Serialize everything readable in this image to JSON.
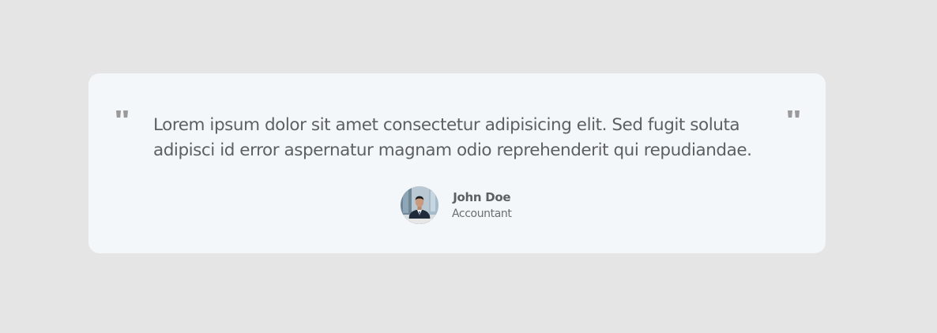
{
  "testimonial": {
    "text": "Lorem ipsum dolor sit amet consectetur adipisicing elit. Sed fugit soluta adipisci id error aspernatur magnam odio reprehenderit qui repudiandae.",
    "author": {
      "name": "John Doe",
      "role": "Accountant"
    },
    "icons": {
      "open_quote": "quote-left-icon",
      "close_quote": "quote-right-icon"
    }
  },
  "colors": {
    "page_background": "#e5e5e5",
    "card_background": "#f4f7fa",
    "text": "#5c5f63",
    "quote_mark": "#9a9a9a"
  }
}
